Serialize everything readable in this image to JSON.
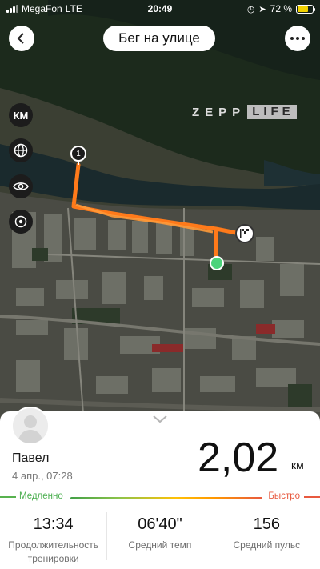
{
  "status_bar": {
    "carrier": "MegaFon",
    "network": "LTE",
    "time": "20:49",
    "battery": "72 %",
    "battery_level": 0.72
  },
  "header": {
    "title": "Бег на улице",
    "back_icon": "chevron-left-icon",
    "more_icon": "more-horizontal-icon"
  },
  "map": {
    "watermark_a": "ZEPP",
    "watermark_b": "LIFE",
    "unit_toggle": "КМ",
    "controls": [
      "globe-icon",
      "eye-icon",
      "locate-icon"
    ],
    "km_marker": "1",
    "route_color": "#ff7a1a",
    "start_color": "#4cd37a",
    "finish_icon": "checkered-flag-icon"
  },
  "workout": {
    "user_name": "Павел",
    "date": "4 апр., 07:28",
    "distance": "2,02",
    "distance_unit": "км",
    "pace_slow_label": "Медленно",
    "pace_fast_label": "Быстро",
    "stats": [
      {
        "value": "13:34",
        "label": "Продолжительность тренировки"
      },
      {
        "value": "06'40\"",
        "label": "Средний темп"
      },
      {
        "value": "156",
        "label": "Средний пульс"
      }
    ]
  },
  "colors": {
    "slow": "#4caf50",
    "fast": "#e8593f"
  }
}
